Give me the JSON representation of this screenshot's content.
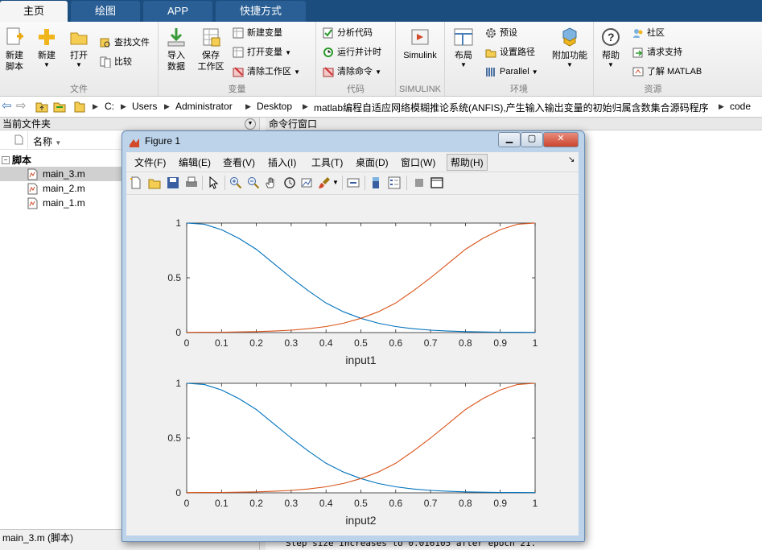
{
  "tabs": [
    {
      "label": "主页",
      "active": true
    },
    {
      "label": "绘图",
      "active": false
    },
    {
      "label": "APP",
      "active": false
    },
    {
      "label": "快捷方式",
      "active": false
    }
  ],
  "ribbon": {
    "file": {
      "group_label": "文件",
      "new_script": "新建\n脚本",
      "new": "新建",
      "open": "打开",
      "find_files": "查找文件",
      "compare": "比较"
    },
    "variable": {
      "group_label": "变量",
      "import": "导入\n数据",
      "save_ws": "保存\n工作区",
      "new_var": "新建变量",
      "open_var": "打开变量",
      "clear_ws": "清除工作区"
    },
    "code": {
      "group_label": "代码",
      "analyze": "分析代码",
      "run_time": "运行并计时",
      "clear_cmd": "清除命令"
    },
    "simulink": {
      "group_label": "SIMULINK",
      "simulink": "Simulink"
    },
    "env": {
      "group_label": "环境",
      "layout": "布局",
      "prefs": "预设",
      "set_path": "设置路径",
      "parallel": "Parallel",
      "addons": "附加功能"
    },
    "resources": {
      "group_label": "资源",
      "help": "帮助",
      "community": "社区",
      "support": "请求支持",
      "learn": "了解 MATLAB"
    }
  },
  "address": {
    "segments": [
      "C:",
      "Users",
      "Administrator",
      "Desktop",
      "matlab编程自适应网络模糊推论系统(ANFIS),产生输入输出变量的初始归属含数集合源码程序",
      "code"
    ]
  },
  "left_panel": {
    "title": "当前文件夹",
    "col_name": "名称",
    "group": "脚本",
    "files": [
      "main_3.m",
      "main_2.m",
      "main_1.m"
    ],
    "status": "main_3.m  (脚本)"
  },
  "right_panel": {
    "title": "命令行窗口",
    "last_line": "Step size increases to 0.016105 after epoch 21."
  },
  "figure": {
    "title": "Figure 1",
    "menus": [
      "文件(F)",
      "编辑(E)",
      "查看(V)",
      "插入(I)",
      "工具(T)",
      "桌面(D)",
      "窗口(W)",
      "帮助(H)"
    ]
  },
  "colors": {
    "series1": "#0072bd",
    "series2": "#d95319",
    "tabbar": "#1b4d7f"
  },
  "chart_data": [
    {
      "type": "line",
      "title": "",
      "xlabel": "input1",
      "ylabel": "",
      "xlim": [
        0,
        1
      ],
      "ylim": [
        0,
        1
      ],
      "xticks": [
        "0",
        "0.1",
        "0.2",
        "0.3",
        "0.4",
        "0.5",
        "0.6",
        "0.7",
        "0.8",
        "0.9",
        "1"
      ],
      "yticks": [
        "0",
        "0.5",
        "1"
      ],
      "x": [
        0,
        0.05,
        0.1,
        0.15,
        0.2,
        0.25,
        0.3,
        0.35,
        0.4,
        0.45,
        0.5,
        0.55,
        0.6,
        0.65,
        0.7,
        0.75,
        0.8,
        0.85,
        0.9,
        0.95,
        1
      ],
      "series": [
        {
          "values": [
            1.0,
            0.99,
            0.94,
            0.86,
            0.76,
            0.63,
            0.5,
            0.38,
            0.27,
            0.19,
            0.13,
            0.085,
            0.055,
            0.035,
            0.022,
            0.014,
            0.009,
            0.006,
            0.004,
            0.003,
            0.002
          ]
        },
        {
          "values": [
            0.002,
            0.003,
            0.004,
            0.006,
            0.009,
            0.014,
            0.022,
            0.035,
            0.055,
            0.085,
            0.13,
            0.19,
            0.27,
            0.38,
            0.5,
            0.63,
            0.76,
            0.86,
            0.94,
            0.99,
            1.0
          ]
        }
      ],
      "grid": false
    },
    {
      "type": "line",
      "title": "",
      "xlabel": "input2",
      "ylabel": "",
      "xlim": [
        0,
        1
      ],
      "ylim": [
        0,
        1
      ],
      "xticks": [
        "0",
        "0.1",
        "0.2",
        "0.3",
        "0.4",
        "0.5",
        "0.6",
        "0.7",
        "0.8",
        "0.9",
        "1"
      ],
      "yticks": [
        "0",
        "0.5",
        "1"
      ],
      "x": [
        0,
        0.05,
        0.1,
        0.15,
        0.2,
        0.25,
        0.3,
        0.35,
        0.4,
        0.45,
        0.5,
        0.55,
        0.6,
        0.65,
        0.7,
        0.75,
        0.8,
        0.85,
        0.9,
        0.95,
        1
      ],
      "series": [
        {
          "values": [
            1.0,
            0.99,
            0.94,
            0.86,
            0.76,
            0.63,
            0.5,
            0.38,
            0.27,
            0.19,
            0.13,
            0.085,
            0.055,
            0.035,
            0.022,
            0.014,
            0.009,
            0.006,
            0.004,
            0.003,
            0.002
          ]
        },
        {
          "values": [
            0.002,
            0.003,
            0.004,
            0.006,
            0.009,
            0.014,
            0.022,
            0.035,
            0.055,
            0.085,
            0.13,
            0.19,
            0.27,
            0.38,
            0.5,
            0.63,
            0.76,
            0.86,
            0.94,
            0.99,
            1.0
          ]
        }
      ],
      "grid": false
    }
  ]
}
